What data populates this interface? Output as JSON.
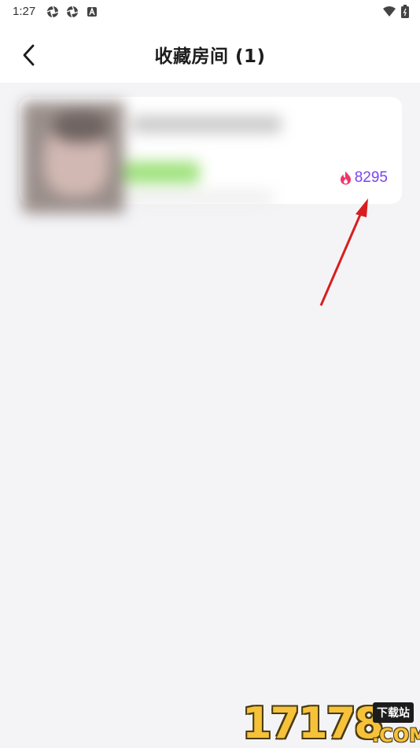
{
  "status_bar": {
    "time": "1:27",
    "left_icons": [
      "aperture-icon",
      "aperture-icon",
      "a-badge-icon"
    ],
    "right_icons": [
      "wifi-icon",
      "battery-icon"
    ]
  },
  "header": {
    "back_icon": "chevron-left-icon",
    "title": "收藏房间 (1)"
  },
  "rooms": [
    {
      "thumbnail": "blurred",
      "heat_icon": "flame-icon",
      "heat_value": "8295"
    }
  ],
  "annotation": {
    "type": "red-arrow",
    "color": "#d81e1e"
  },
  "watermark": {
    "number": "17178",
    "tag": "下载站",
    "domain": ".COM"
  },
  "colors": {
    "background": "#f4f4f7",
    "card": "#ffffff",
    "heat_text": "#7a44ee",
    "flame": "#f0356b",
    "watermark": "#f6c23a"
  }
}
